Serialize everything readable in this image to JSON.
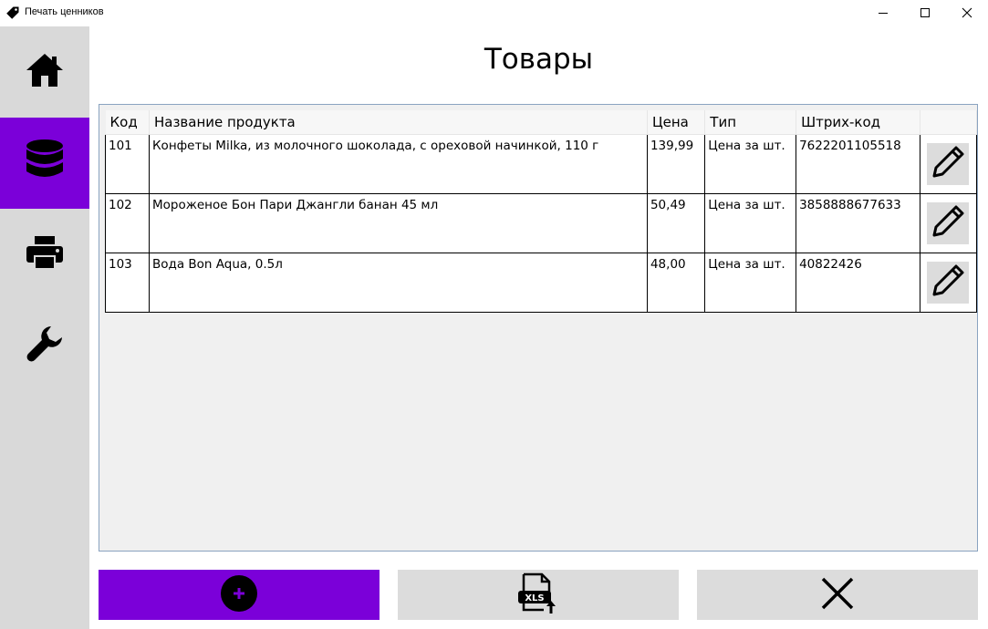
{
  "window": {
    "title": "Печать ценников",
    "icon": "price-tag-icon",
    "controls": [
      "minimize-icon",
      "maximize-icon",
      "close-icon"
    ]
  },
  "sidebar": {
    "items": [
      {
        "name": "home",
        "icon": "home-icon",
        "active": false
      },
      {
        "name": "database",
        "icon": "database-icon",
        "active": true
      },
      {
        "name": "print",
        "icon": "printer-icon",
        "active": false
      },
      {
        "name": "settings",
        "icon": "wrench-icon",
        "active": false
      }
    ],
    "active_color": "#7b00d9"
  },
  "main": {
    "title": "Товары",
    "table": {
      "headers": {
        "code": "Код",
        "name": "Название продукта",
        "price": "Цена",
        "type": "Тип",
        "barcode": "Штрих-код"
      },
      "rows": [
        {
          "code": "101",
          "name": "Конфеты Milka, из молочного шоколада, с ореховой начинкой, 110 г",
          "price": "139,99",
          "type": "Цена за шт.",
          "barcode": "7622201105518",
          "action_icon": "pencil-icon"
        },
        {
          "code": "102",
          "name": "Мороженое Бон Пари Джангли банан 45 мл",
          "price": "50,49",
          "type": "Цена за шт.",
          "barcode": "3858888677633",
          "action_icon": "pencil-icon"
        },
        {
          "code": "103",
          "name": "Вода Bon Aqua, 0.5л",
          "price": "48,00",
          "type": "Цена за шт.",
          "barcode": "40822426",
          "action_icon": "pencil-icon"
        }
      ]
    }
  },
  "bottom_bar": {
    "add": {
      "icon": "plus-circle-icon",
      "color": "#7b00d9"
    },
    "export": {
      "icon": "xls-export-icon",
      "icon_text": "XLS"
    },
    "close": {
      "icon": "close-x-icon"
    }
  }
}
